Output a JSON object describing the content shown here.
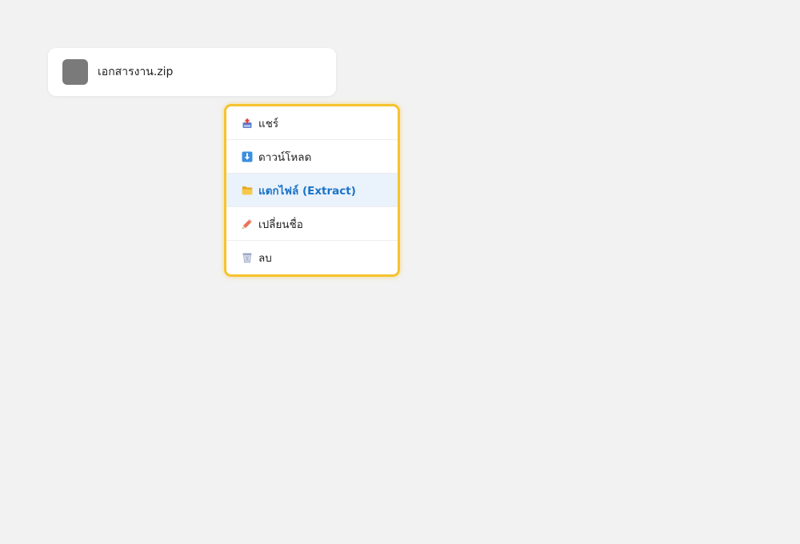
{
  "file": {
    "name": "เอกสารงาน.zip"
  },
  "menu": {
    "items": [
      {
        "label": "แชร์",
        "icon": "share-tray-icon"
      },
      {
        "label": "ดาวน์โหลด",
        "icon": "download-arrow-icon"
      },
      {
        "label": "แตกไฟล์ (Extract)",
        "icon": "folder-icon",
        "active": true
      },
      {
        "label": "เปลี่ยนชื่อ",
        "icon": "pencil-icon"
      },
      {
        "label": "ลบ",
        "icon": "trash-icon"
      }
    ],
    "accent": "#f6c32f",
    "highlight_bg": "#eaf2fb",
    "highlight_text": "#1a73c8"
  }
}
